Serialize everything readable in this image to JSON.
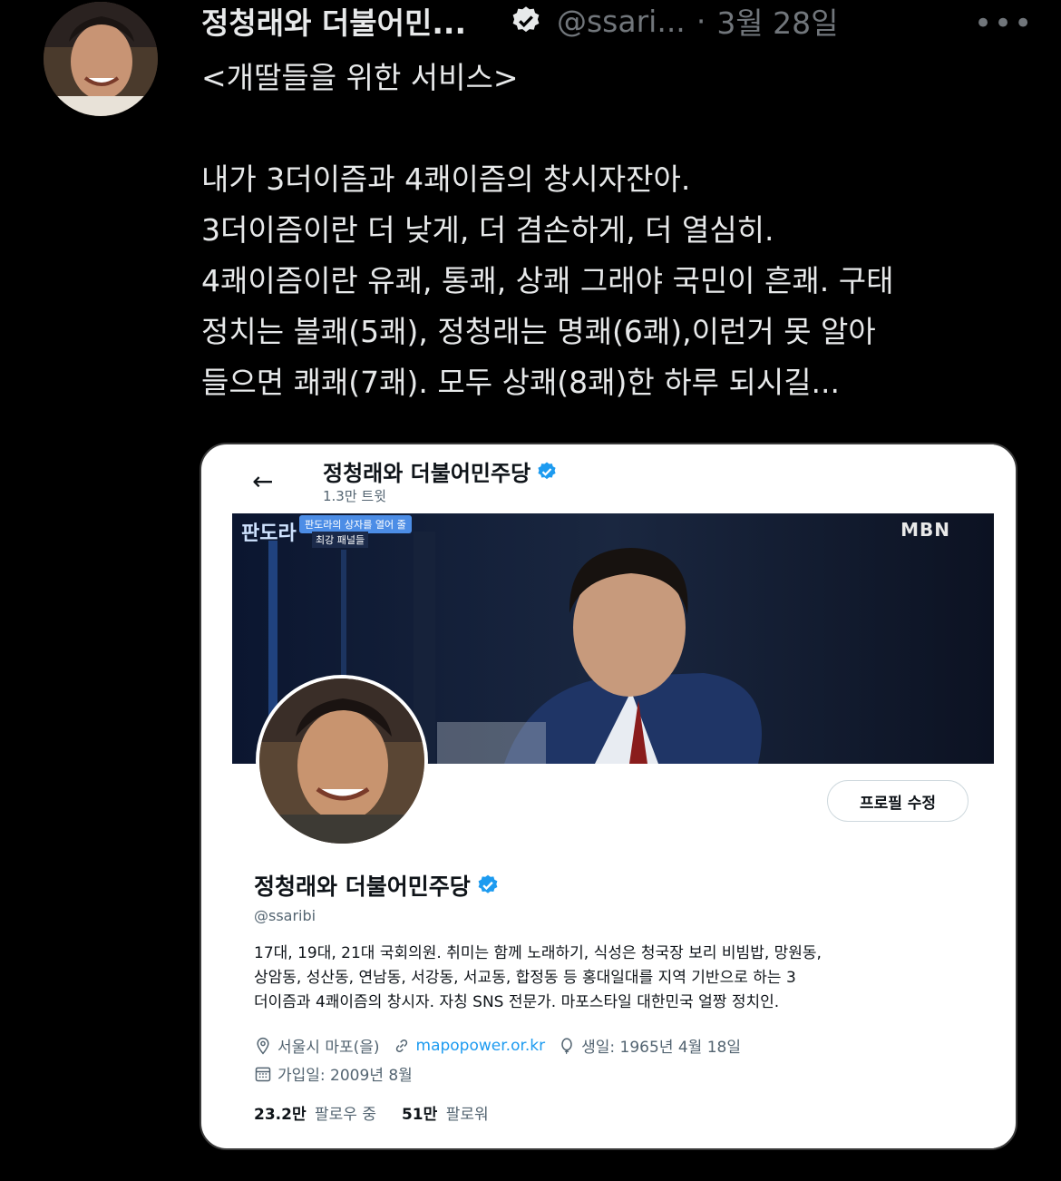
{
  "tweet": {
    "author_name": "정청래와 더불어민...",
    "handle": "@ssari...",
    "separator": "·",
    "date": "3월 28일",
    "more_label": "•••",
    "lines": [
      "<개딸들을 위한 서비스>",
      "",
      "내가 3더이즘과 4쾌이즘의 창시자잔아.",
      "3더이즘이란 더 낮게, 더 겸손하게, 더 열심히.",
      "4쾌이즘이란 유쾌, 통쾌, 상쾌 그래야 국민이 흔쾌. 구태",
      "정치는 불쾌(5쾌), 정청래는 명쾌(6쾌),이런거 못 알아",
      "들으면 쾌쾌(7쾌). 모두 상쾌(8쾌)한 하루 되시길..."
    ]
  },
  "card": {
    "back_label": "←",
    "title": "정청래와 더불어민주당",
    "tweet_count": "1.3만 트윗",
    "banner": {
      "logo": "MBN",
      "show_title": "판도라",
      "caption": "판도라의 상자를 열어 줄",
      "caption_sub": "최강 패널들"
    },
    "edit_profile": "프로필 수정",
    "profile_name": "정청래와 더불어민주당",
    "profile_handle": "@ssaribi",
    "bio_lines": [
      "17대, 19대, 21대 국회의원. 취미는 함께 노래하기, 식성은 청국장 보리 비빔밥, 망원동,",
      "상암동, 성산동, 연남동, 서강동, 서교동, 합정동 등 홍대일대를 지역 기반으로 하는 3",
      "더이즘과 4쾌이즘의 창시자. 자칭 SNS 전문가. 마포스타일 대한민국 얼짱 정치인."
    ],
    "location": "서울시 마포(을)",
    "website": "mapopower.or.kr",
    "birthday": "생일: 1965년 4월 18일",
    "joined": "가입일: 2009년 8월",
    "following_count": "23.2만",
    "following_label": "팔로우 중",
    "followers_count": "51만",
    "followers_label": "팔로워"
  },
  "colors": {
    "background": "#000000",
    "verified": "#1d9bf0",
    "text_primary": "#e7e9ea",
    "text_secondary": "#71767b",
    "link": "#1d9bf0"
  }
}
